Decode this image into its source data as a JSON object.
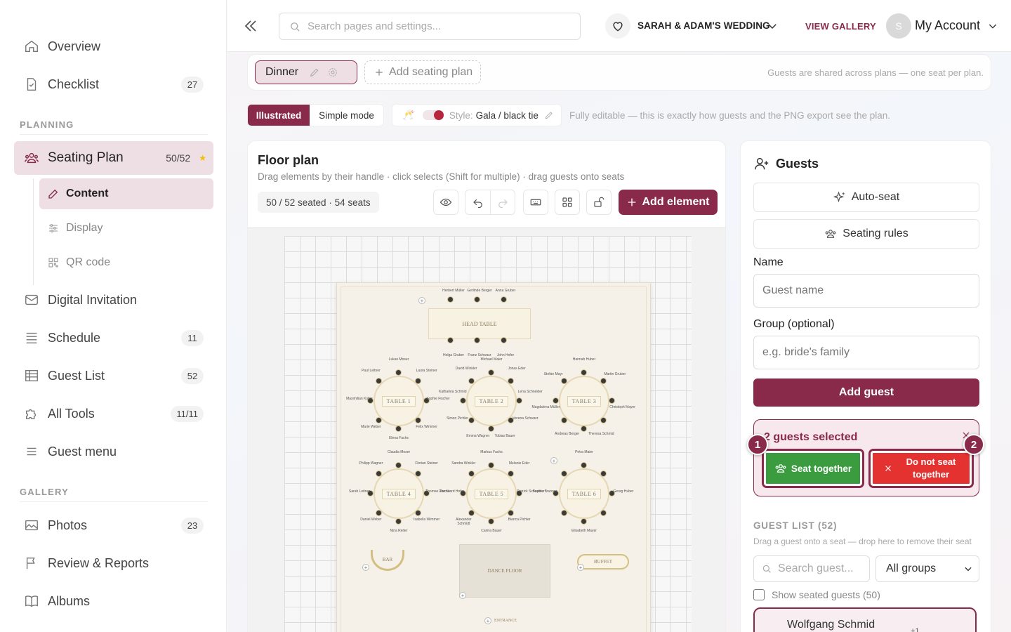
{
  "sidebar": {
    "items": [
      {
        "label": "Overview",
        "icon": "home-icon"
      },
      {
        "label": "Checklist",
        "icon": "checklist-icon",
        "badge": "27"
      },
      {
        "label": "Seating Plan",
        "icon": "people-icon",
        "badge": "50/52",
        "active": true
      },
      {
        "label": "Digital Invitation",
        "icon": "mail-icon"
      },
      {
        "label": "Schedule",
        "icon": "schedule-icon",
        "badge": "11"
      },
      {
        "label": "Guest List",
        "icon": "table-icon",
        "badge": "52"
      },
      {
        "label": "All Tools",
        "icon": "puzzle-icon",
        "badge": "11/11"
      },
      {
        "label": "Guest menu",
        "icon": "menu-icon"
      },
      {
        "label": "Photos",
        "icon": "image-icon",
        "badge": "23"
      },
      {
        "label": "Review & Reports",
        "icon": "flag-icon"
      },
      {
        "label": "Albums",
        "icon": "book-icon"
      }
    ],
    "sub_items": [
      {
        "label": "Content",
        "icon": "edit-icon",
        "active": true
      },
      {
        "label": "Display",
        "icon": "sliders-icon"
      },
      {
        "label": "QR code",
        "icon": "qr-icon"
      }
    ],
    "sections": {
      "planning": "PLANNING",
      "gallery": "GALLERY"
    }
  },
  "topbar": {
    "search_placeholder": "Search pages and settings...",
    "event_name": "SARAH & ADAM'S WEDDING",
    "view_gallery": "VIEW GALLERY",
    "avatar_initial": "S",
    "account": "My Account"
  },
  "plans": {
    "active": "Dinner",
    "add_label": "Add seating plan",
    "note": "Guests are shared across plans — one seat per plan."
  },
  "mode": {
    "illustrated": "Illustrated",
    "simple": "Simple mode",
    "style_label": "Style:",
    "style_value": "Gala / black tie",
    "note": "Fully editable — this is exactly how guests and the PNG export see the plan."
  },
  "floor": {
    "title": "Floor plan",
    "subtitle": "Drag elements by their handle · click selects (Shift for multiple) · drag guests onto seats",
    "count": "50 / 52 seated · 54 seats",
    "add_element": "Add element",
    "head_table": "HEAD TABLE",
    "head_guests_top": [
      "Herbert Müller",
      "Gerlinde Berger",
      "Anna Gruber"
    ],
    "head_guests_bottom": [
      "Helga Gruber",
      "Franz Schwarz",
      "John Hofer"
    ],
    "tables": [
      {
        "label": "TABLE 1",
        "guests": [
          "Lukas Moser",
          "Laura Steiner",
          "Sophie Fischer",
          "Felix Wimmer",
          "Elena Fuchs",
          "Marie Weber",
          "Maximilian Koller",
          "Paul Leitner"
        ]
      },
      {
        "label": "TABLE 2",
        "guests": [
          "Michael Maier",
          "Jonas Eder",
          "Lena Schneider",
          "Verena Schwarz",
          "Tobias Bauer",
          "Emma Wagner",
          "Simon Pichler",
          "Katharina Schmid",
          "David Winkler"
        ]
      },
      {
        "label": "TABLE 3",
        "guests": [
          "Hannah Huber",
          "Martin Gruber",
          "Christoph Mayer",
          "Theresa Schmid",
          "Andreas Berger",
          "Magdalena Müller",
          "Stefan Mayr"
        ]
      },
      {
        "label": "TABLE 4",
        "guests": [
          "Claudia Moser",
          "Florian Steiner",
          "Thomas Fischer",
          "Isabella Wimmer",
          "Nina Reiter",
          "Daniel Weber",
          "Sarah Leitner",
          "Philipp Wagner"
        ]
      },
      {
        "label": "TABLE 5",
        "guests": [
          "Markus Fuchs",
          "Melanie Eder",
          "Patrick Schneider",
          "Bianca Pichler",
          "Carina Bauer",
          "Alexander Schmidt",
          "Bernhard Hofer",
          "Sandra Winkler"
        ]
      },
      {
        "label": "TABLE 6",
        "guests": [
          "Petra Maier",
          "Georg Huber",
          "Elisabeth Mayer",
          "Sophie Brunner"
        ]
      }
    ],
    "bar": "BAR",
    "buffet": "BUFFET",
    "dance_floor": "DANCE FLOOR",
    "entrance": "ENTRANCE"
  },
  "guests": {
    "title": "Guests",
    "auto_seat": "Auto-seat",
    "rules": "Seating rules",
    "name_label": "Name",
    "name_placeholder": "Guest name",
    "group_label": "Group (optional)",
    "group_placeholder": "e.g. bride's family",
    "add_guest": "Add guest",
    "selected": "2 guests selected",
    "seat_together": "Seat together",
    "not_seat_together": "Do not seat together",
    "step1": "1",
    "step2": "2",
    "list_header": "GUEST LIST (52)",
    "list_sub": "Drag a guest onto a seat — drop here to remove their seat",
    "search_placeholder": "Search guest...",
    "group_filter": "All groups",
    "show_seated": "Show seated guests (50)",
    "first_guest": "Wolfgang Schmid",
    "first_guest_extra": "+1"
  },
  "colors": {
    "accent": "#8a2a4a",
    "green": "#3a9c3f",
    "red": "#e3322f"
  }
}
